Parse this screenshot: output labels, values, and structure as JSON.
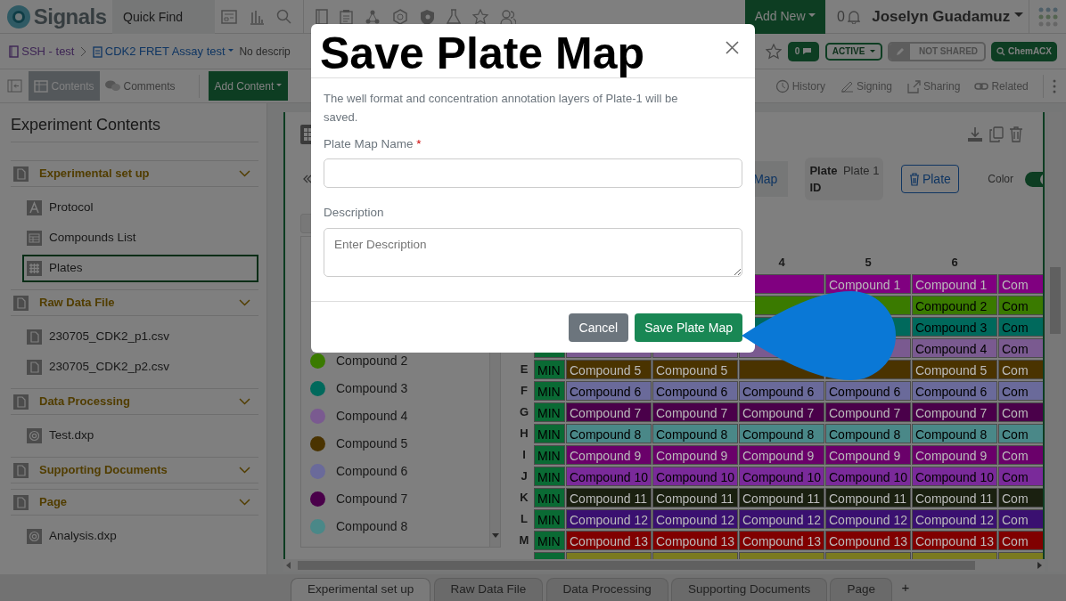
{
  "app": {
    "brand": "Signals",
    "quick_find": {
      "placeholder": "Quick Find"
    },
    "add_new": "Add New",
    "notifications": "0",
    "user": "Joselyn Guadamuz"
  },
  "breadcrumb": {
    "notebook": "SSH - test",
    "experiment": "CDK2 FRET Assay test",
    "description": "No descrip"
  },
  "status": {
    "starred": false,
    "comments": "0",
    "state": "ACTIVE",
    "sharing": "NOT SHARED",
    "search": "ChemACX"
  },
  "toolbar": {
    "tabs": [
      {
        "label": "Contents",
        "selected": true
      },
      {
        "label": "Comments",
        "selected": false
      }
    ],
    "add_content": "Add Content",
    "actions": [
      "History",
      "Signing",
      "Sharing",
      "Related"
    ]
  },
  "sidebar": {
    "title": "Experiment Contents",
    "sections": [
      {
        "title": "Experimental set up",
        "expanded": true,
        "items": [
          {
            "name": "Protocol",
            "kind": "text",
            "selected": false
          },
          {
            "name": "Compounds List",
            "kind": "table",
            "selected": false
          },
          {
            "name": "Plates",
            "kind": "plate",
            "selected": true
          }
        ]
      },
      {
        "title": "Raw Data File",
        "expanded": true,
        "items": [
          {
            "name": "230705_CDK2_p1.csv",
            "kind": "file",
            "selected": false
          },
          {
            "name": "230705_CDK2_p2.csv",
            "kind": "file",
            "selected": false
          }
        ]
      },
      {
        "title": "Data Processing",
        "expanded": true,
        "items": [
          {
            "name": "Test.dxp",
            "kind": "analysis",
            "selected": false
          }
        ]
      },
      {
        "title": "Supporting Documents",
        "expanded": true
      },
      {
        "title": "Page",
        "expanded": true,
        "items": [
          {
            "name": "Analysis.dxp",
            "kind": "analysis",
            "selected": false
          }
        ]
      }
    ]
  },
  "plate": {
    "map_button": "Map",
    "plate_id": {
      "label": "Plate ID",
      "value": "Plate 1"
    },
    "delete_button": "Plate",
    "color_toggle": {
      "label": "Color",
      "on": true
    },
    "legend": [
      {
        "name": "Compound 2",
        "color": "#3a7a00"
      },
      {
        "name": "Compound 3",
        "color": "#00695c"
      },
      {
        "name": "Compound 4",
        "color": "#7a5a90"
      },
      {
        "name": "Compound 5",
        "color": "#4a3300"
      },
      {
        "name": "Compound 6",
        "color": "#6a6a9a"
      },
      {
        "name": "Compound 7",
        "color": "#4a004a"
      },
      {
        "name": "Compound 8",
        "color": "#4a8888"
      }
    ],
    "columns": [
      "",
      "",
      "4",
      "5",
      "6",
      ""
    ],
    "rows": [
      {
        "color": "#800080",
        "cells": [
          "",
          "",
          "",
          "Compound 1",
          "Compound 1",
          "Com"
        ]
      },
      {
        "color": "#3a7a00",
        "cells": [
          "",
          "",
          "",
          "",
          "Compound 2",
          "Com"
        ]
      },
      {
        "color": "#00695c",
        "cells": [
          "",
          "",
          "",
          "",
          "Compound 3",
          "Com"
        ]
      },
      {
        "color": "#7a5a90",
        "cells": [
          "",
          "",
          "",
          "",
          "Compound 4",
          "Com"
        ]
      },
      {
        "label": "E",
        "min": "MIN",
        "color": "#4a3300",
        "cells": [
          "Compound 5",
          "Compound 5",
          "",
          "",
          "Compound 5",
          "Com"
        ]
      },
      {
        "label": "F",
        "min": "MIN",
        "color": "#6a6a9a",
        "cells": [
          "Compound 6",
          "Compound 6",
          "Compound 6",
          "Compound 6",
          "Compound 6",
          "Com"
        ]
      },
      {
        "label": "G",
        "min": "MIN",
        "color": "#4a004a",
        "cells": [
          "Compound 7",
          "Compound 7",
          "Compound 7",
          "Compound 7",
          "Compound 7",
          "Com"
        ]
      },
      {
        "label": "H",
        "min": "MIN",
        "color": "#4a8888",
        "cells": [
          "Compound 8",
          "Compound 8",
          "Compound 8",
          "Compound 8",
          "Compound 8",
          "Com"
        ]
      },
      {
        "label": "I",
        "min": "MIN",
        "color": "#6a006a",
        "cells": [
          "Compound 9",
          "Compound 9",
          "Compound 9",
          "Compound 9",
          "Compound 9",
          "Com"
        ]
      },
      {
        "label": "J",
        "min": "MIN",
        "color": "#7a2a9a",
        "cells": [
          "Compound 10",
          "Compound 10",
          "Compound 10",
          "Compound 10",
          "Compound 10",
          "Com"
        ]
      },
      {
        "label": "K",
        "min": "MIN",
        "color": "#1a2010",
        "cells": [
          "Compound 11",
          "Compound 11",
          "Compound 11",
          "Compound 11",
          "Compound 11",
          "Com"
        ]
      },
      {
        "label": "L",
        "min": "MIN",
        "color": "#3a1070",
        "cells": [
          "Compound 12",
          "Compound 12",
          "Compound 12",
          "Compound 12",
          "Compound 12",
          "Com"
        ]
      },
      {
        "label": "M",
        "min": "MIN",
        "color": "#800000",
        "cells": [
          "Compound 13",
          "Compound 13",
          "Compound 13",
          "Compound 13",
          "Compound 13",
          "Com"
        ]
      },
      {
        "color": "#7a7a20",
        "cells": [
          "",
          "",
          "",
          "",
          "",
          ""
        ]
      }
    ]
  },
  "bottom_tabs": [
    {
      "label": "Experimental set up",
      "selected": true
    },
    {
      "label": "Raw Data File",
      "selected": false
    },
    {
      "label": "Data Processing",
      "selected": false
    },
    {
      "label": "Supporting Documents",
      "selected": false
    },
    {
      "label": "Page",
      "selected": false
    }
  ],
  "add_tab": "+",
  "dialog": {
    "title": "Save Plate Map",
    "message": "The well format and concentration annotation layers of Plate-1 will be saved.",
    "name_field": {
      "label": "Plate Map Name",
      "required_mark": "*"
    },
    "description_field": {
      "label": "Description",
      "placeholder": "Enter Description"
    },
    "cancel": "Cancel",
    "save": "Save Plate Map"
  }
}
